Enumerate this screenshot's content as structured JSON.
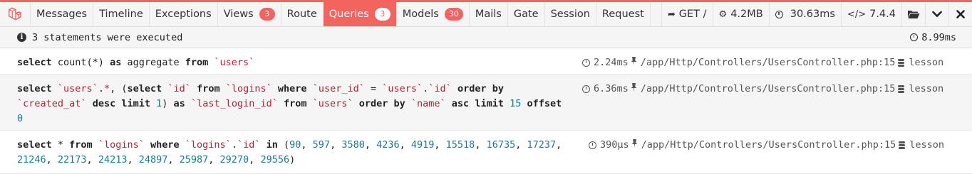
{
  "header": {
    "tabs": [
      {
        "label": "Messages",
        "badge": null,
        "active": false
      },
      {
        "label": "Timeline",
        "badge": null,
        "active": false
      },
      {
        "label": "Exceptions",
        "badge": null,
        "active": false
      },
      {
        "label": "Views",
        "badge": "3",
        "active": false
      },
      {
        "label": "Route",
        "badge": null,
        "active": false
      },
      {
        "label": "Queries",
        "badge": "3",
        "active": true
      },
      {
        "label": "Models",
        "badge": "30",
        "active": false
      },
      {
        "label": "Mails",
        "badge": null,
        "active": false
      },
      {
        "label": "Gate",
        "badge": null,
        "active": false
      },
      {
        "label": "Session",
        "badge": null,
        "active": false
      },
      {
        "label": "Request",
        "badge": null,
        "active": false
      }
    ],
    "request": "GET /",
    "memory": "4.2MB",
    "duration": "30.63ms",
    "php_version": "7.4.4"
  },
  "summary": {
    "text": "3 statements were executed",
    "total_time": "8.99ms"
  },
  "statements": [
    {
      "lines": [
        [
          [
            "kw",
            "select"
          ],
          [
            "t",
            " count(*) "
          ],
          [
            "kw",
            "as"
          ],
          [
            "t",
            " aggregate "
          ],
          [
            "kw",
            "from"
          ],
          [
            "t",
            " "
          ],
          [
            "id",
            "`users`"
          ]
        ]
      ],
      "time": "2.24ms",
      "source": "/app/Http/Controllers/UsersController.php:15",
      "connection": "lesson"
    },
    {
      "lines": [
        [
          [
            "kw",
            "select"
          ],
          [
            "t",
            " "
          ],
          [
            "id",
            "`users`"
          ],
          [
            "t",
            "."
          ],
          [
            "id",
            "*"
          ],
          [
            "t",
            ", ("
          ],
          [
            "kw",
            "select"
          ],
          [
            "t",
            " "
          ],
          [
            "id",
            "`id`"
          ],
          [
            "t",
            " "
          ],
          [
            "kw",
            "from"
          ],
          [
            "t",
            " "
          ],
          [
            "id",
            "`logins`"
          ],
          [
            "t",
            " "
          ],
          [
            "kw",
            "where"
          ],
          [
            "t",
            " "
          ],
          [
            "id",
            "`user_id`"
          ],
          [
            "t",
            " = "
          ],
          [
            "id",
            "`users`"
          ],
          [
            "t",
            "."
          ],
          [
            "id",
            "`id`"
          ],
          [
            "t",
            " "
          ],
          [
            "kw",
            "order by"
          ]
        ],
        [
          [
            "id",
            "`created_at`"
          ],
          [
            "t",
            " "
          ],
          [
            "kw",
            "desc"
          ],
          [
            "t",
            " "
          ],
          [
            "kw",
            "limit"
          ],
          [
            "t",
            " "
          ],
          [
            "num",
            "1"
          ],
          [
            "t",
            ") "
          ],
          [
            "kw",
            "as"
          ],
          [
            "t",
            " "
          ],
          [
            "id",
            "`last_login_id`"
          ],
          [
            "t",
            " "
          ],
          [
            "kw",
            "from"
          ],
          [
            "t",
            " "
          ],
          [
            "id",
            "`users`"
          ],
          [
            "t",
            " "
          ],
          [
            "kw",
            "order by"
          ],
          [
            "t",
            " "
          ],
          [
            "id",
            "`name`"
          ],
          [
            "t",
            " "
          ],
          [
            "kw",
            "asc"
          ],
          [
            "t",
            " "
          ],
          [
            "kw",
            "limit"
          ],
          [
            "t",
            " "
          ],
          [
            "num",
            "15"
          ],
          [
            "t",
            " "
          ],
          [
            "kw",
            "offset"
          ]
        ],
        [
          [
            "num",
            "0"
          ]
        ]
      ],
      "time": "6.36ms",
      "source": "/app/Http/Controllers/UsersController.php:15",
      "connection": "lesson"
    },
    {
      "lines": [
        [
          [
            "kw",
            "select"
          ],
          [
            "t",
            " * "
          ],
          [
            "kw",
            "from"
          ],
          [
            "t",
            " "
          ],
          [
            "id",
            "`logins`"
          ],
          [
            "t",
            " "
          ],
          [
            "kw",
            "where"
          ],
          [
            "t",
            " "
          ],
          [
            "id",
            "`logins`"
          ],
          [
            "t",
            "."
          ],
          [
            "id",
            "`id`"
          ],
          [
            "t",
            " "
          ],
          [
            "kw",
            "in"
          ],
          [
            "t",
            " ("
          ],
          [
            "num",
            "90"
          ],
          [
            "t",
            ", "
          ],
          [
            "num",
            "597"
          ],
          [
            "t",
            ", "
          ],
          [
            "num",
            "3580"
          ],
          [
            "t",
            ", "
          ],
          [
            "num",
            "4236"
          ],
          [
            "t",
            ", "
          ],
          [
            "num",
            "4919"
          ],
          [
            "t",
            ", "
          ],
          [
            "num",
            "15518"
          ],
          [
            "t",
            ", "
          ],
          [
            "num",
            "16735"
          ],
          [
            "t",
            ", "
          ],
          [
            "num",
            "17237"
          ],
          [
            "t",
            ","
          ]
        ],
        [
          [
            "num",
            "21246"
          ],
          [
            "t",
            ", "
          ],
          [
            "num",
            "22173"
          ],
          [
            "t",
            ", "
          ],
          [
            "num",
            "24213"
          ],
          [
            "t",
            ", "
          ],
          [
            "num",
            "24897"
          ],
          [
            "t",
            ", "
          ],
          [
            "num",
            "25987"
          ],
          [
            "t",
            ", "
          ],
          [
            "num",
            "29270"
          ],
          [
            "t",
            ", "
          ],
          [
            "num",
            "29556"
          ],
          [
            "t",
            ")"
          ]
        ]
      ],
      "time": "390μs",
      "source": "/app/Http/Controllers/UsersController.php:15",
      "connection": "lesson"
    }
  ]
}
